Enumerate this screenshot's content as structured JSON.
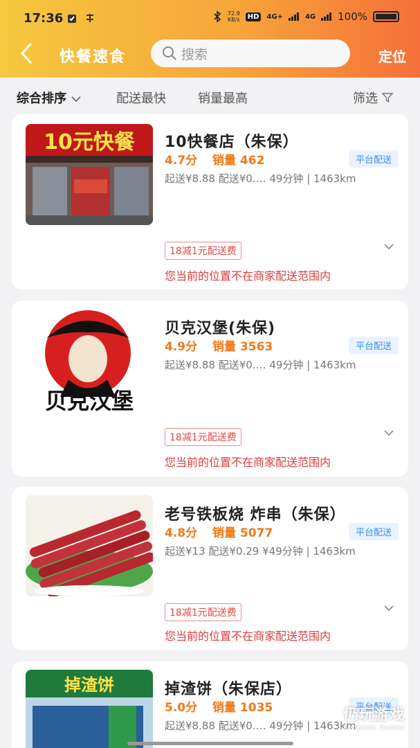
{
  "status_bar": {
    "time": "17:36",
    "speed_value": "72.9",
    "speed_unit": "KB/s",
    "hd": "HD",
    "net1": "4G+",
    "net2": "4G",
    "battery": "100%"
  },
  "nav": {
    "title": "快餐速食",
    "search_placeholder": "搜索",
    "locate_label": "定位"
  },
  "filters": {
    "sort": "综合排序",
    "fastest": "配送最快",
    "top_sales": "销量最高",
    "filter": "筛选"
  },
  "shops": [
    {
      "name": "10快餐店（朱保）",
      "rating": "4.7分",
      "sales": "销量 462",
      "badge": "平台配送",
      "meta": "起送¥8.88 配送¥0.… 49分钟 | 1463km",
      "promo": "18减1元配送费",
      "warning": "您当前的位置不在商家配送范围内",
      "thumb_sign": "10元快餐"
    },
    {
      "name": "贝克汉堡(朱保)",
      "rating": "4.9分",
      "sales": "销量 3563",
      "badge": "平台配送",
      "meta": "起送¥8.88 配送¥0.… 49分钟 | 1463km",
      "promo": "18减1元配送费",
      "warning": "您当前的位置不在商家配送范围内",
      "thumb_sign": "贝克汉堡"
    },
    {
      "name": "老号铁板烧  炸串（朱保）",
      "rating": "4.8分",
      "sales": "销量 5077",
      "badge": "平台配送",
      "meta": "起送¥13 配送¥0.29 ¥49分钟 | 1463km",
      "promo": "18减1元配送费",
      "warning": "您当前的位置不在商家配送范围内"
    },
    {
      "name": "掉渣饼（朱保店）",
      "rating": "5.0分",
      "sales": "销量 1035",
      "badge": "平台配送",
      "meta": "起送¥8.88 配送¥0.… 49分钟 | 1463km",
      "thumb_sign": "掉渣饼"
    }
  ],
  "watermark": {
    "main": "仍玩游戏",
    "sub": "Rengwan Games"
  },
  "colors": {
    "accent_orange": "#f07a1a",
    "warning_red": "#e03b3b",
    "badge_blue": "#3d8ef0"
  }
}
